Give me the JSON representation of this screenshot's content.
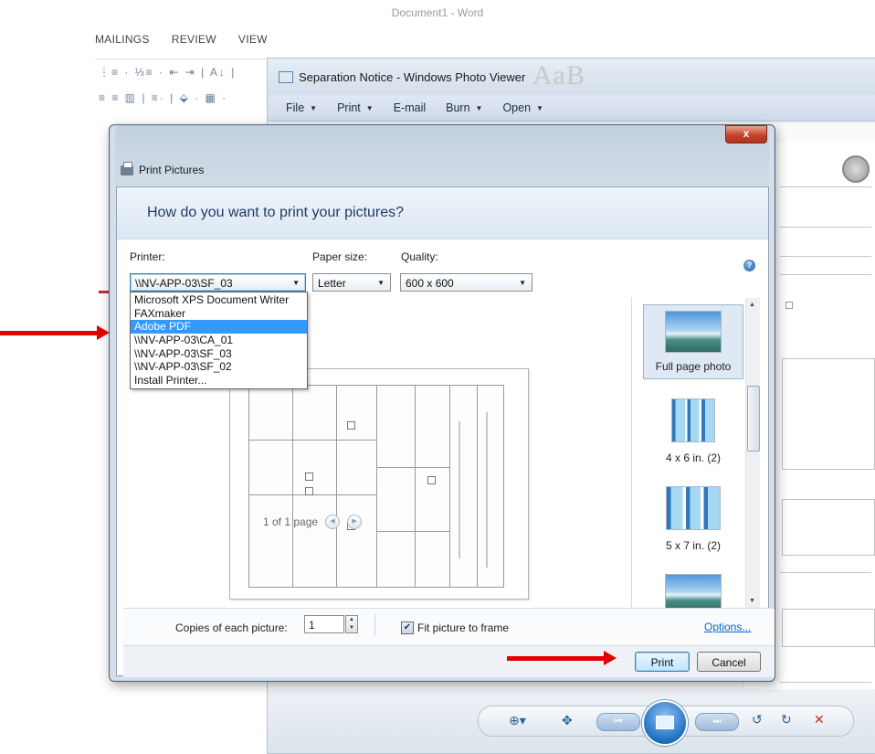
{
  "word": {
    "title": "Document1 - Word",
    "tabs": [
      "MAILINGS",
      "REVIEW",
      "VIEW"
    ],
    "ribbon_row1": "⋮≡ · ⅓≡ · ⇤ ⇥ | A↓ |",
    "ribbon_row2": "≡ ≡ ▥ | ≡· | ⬙ · ▦ ·"
  },
  "photo_viewer": {
    "title": "Separation Notice - Windows Photo Viewer",
    "styles_hint": "AaB",
    "menu": [
      "File",
      "Print",
      "E-mail",
      "Burn",
      "Open"
    ]
  },
  "dialog": {
    "title": "Print Pictures",
    "close_label": "x",
    "question": "How do you want to print your pictures?",
    "printer": {
      "label": "Printer:",
      "value": "\\\\NV-APP-03\\SF_03",
      "options": [
        "Microsoft XPS Document Writer",
        "FAXmaker",
        "Adobe PDF",
        "\\\\NV-APP-03\\CA_01",
        "\\\\NV-APP-03\\SF_03",
        "\\\\NV-APP-03\\SF_02",
        "Install Printer..."
      ],
      "highlighted": "Adobe PDF"
    },
    "paper_size": {
      "label": "Paper size:",
      "value": "Letter"
    },
    "quality": {
      "label": "Quality:",
      "value": "600 x 600"
    },
    "help": "?",
    "page_counter": "1 of 1 page",
    "layouts": [
      {
        "label": "Full page photo",
        "selected": true
      },
      {
        "label": "4 x 6 in. (2)",
        "selected": false
      },
      {
        "label": "5 x 7 in. (2)",
        "selected": false
      }
    ],
    "copies": {
      "label": "Copies of each picture:",
      "value": "1"
    },
    "fit_to_frame": {
      "label": "Fit picture to frame",
      "checked": true
    },
    "options_link": "Options...",
    "print_button": "Print",
    "cancel_button": "Cancel"
  },
  "colors": {
    "accent": "#3399ff",
    "annotation_arrow": "#e00000",
    "close_button": "#c4442b"
  }
}
